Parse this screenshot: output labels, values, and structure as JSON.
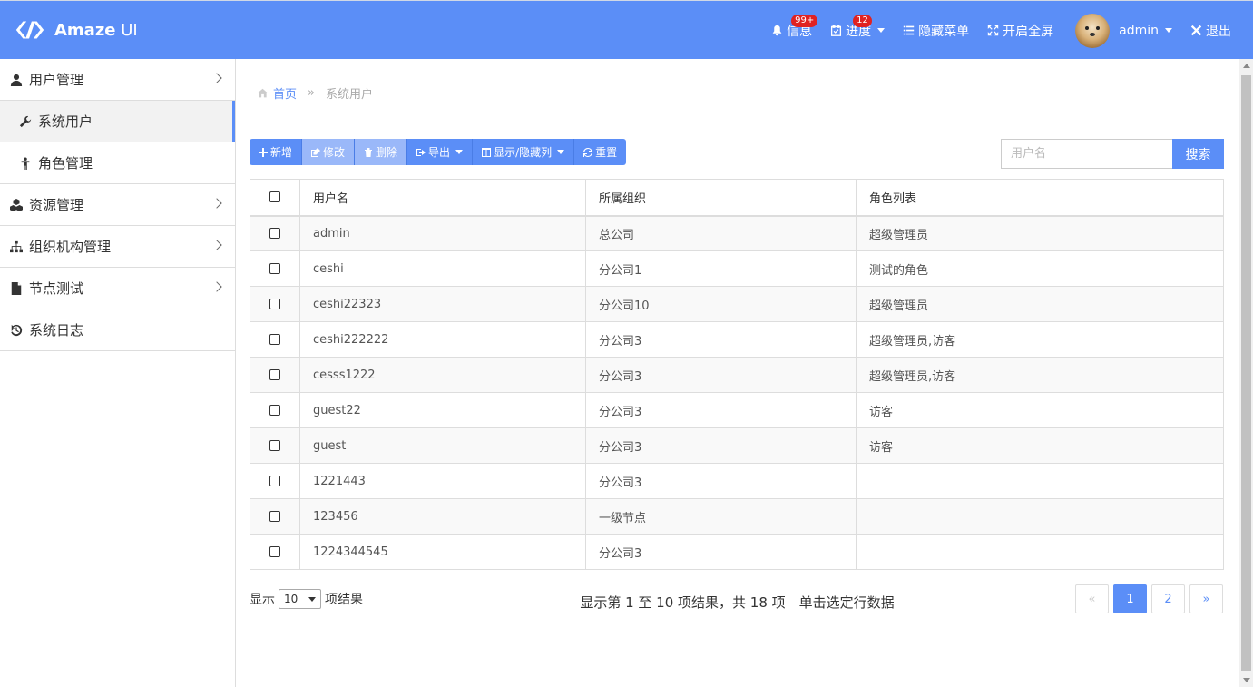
{
  "brand": {
    "name_bold": "Amaze",
    "name_light": " UI",
    "logo_icon": "amaze-logo-icon"
  },
  "header": {
    "messages_label": "信息",
    "messages_badge": "99+",
    "progress_label": "进度",
    "progress_badge": "12",
    "hide_menu_label": "隐藏菜单",
    "fullscreen_label": "开启全屏",
    "user_name": "admin",
    "logout_label": "退出"
  },
  "sidebar": {
    "items": [
      {
        "label": "用户管理",
        "icon": "user-icon"
      },
      {
        "label": "系统用户",
        "icon": "wrench-icon"
      },
      {
        "label": "角色管理",
        "icon": "person-icon"
      },
      {
        "label": "资源管理",
        "icon": "cubes-icon"
      },
      {
        "label": "组织机构管理",
        "icon": "sitemap-icon"
      },
      {
        "label": "节点测试",
        "icon": "file-icon"
      },
      {
        "label": "系统日志",
        "icon": "history-icon"
      }
    ]
  },
  "breadcrumb": {
    "home": "首页",
    "separator": "»",
    "current": "系统用户"
  },
  "toolbar": {
    "add": "新增",
    "edit": "修改",
    "delete": "删除",
    "export": "导出",
    "columns": "显示/隐藏列",
    "reset": "重置"
  },
  "search": {
    "placeholder": "用户名",
    "button": "搜索"
  },
  "table": {
    "columns": [
      "用户名",
      "所属组织",
      "角色列表"
    ],
    "rows": [
      [
        "admin",
        "总公司",
        "超级管理员"
      ],
      [
        "ceshi",
        "分公司1",
        "测试的角色"
      ],
      [
        "ceshi22323",
        "分公司10",
        "超级管理员"
      ],
      [
        "ceshi222222",
        "分公司3",
        "超级管理员,访客"
      ],
      [
        "cesss1222",
        "分公司3",
        "超级管理员,访客"
      ],
      [
        "guest22",
        "分公司3",
        "访客"
      ],
      [
        "guest",
        "分公司3",
        "访客"
      ],
      [
        "1221443",
        "分公司3",
        ""
      ],
      [
        "123456",
        "一级节点",
        ""
      ],
      [
        "1224344545",
        "分公司3",
        ""
      ]
    ]
  },
  "pager": {
    "show_prefix": "显示",
    "page_size": "10",
    "show_suffix": "项结果",
    "info": "显示第 1 至 10 项结果，共 18 项　单击选定行数据",
    "prev": "«",
    "pages": [
      "1",
      "2"
    ],
    "next": "»"
  },
  "colors": {
    "accent": "#5b8ef7"
  }
}
